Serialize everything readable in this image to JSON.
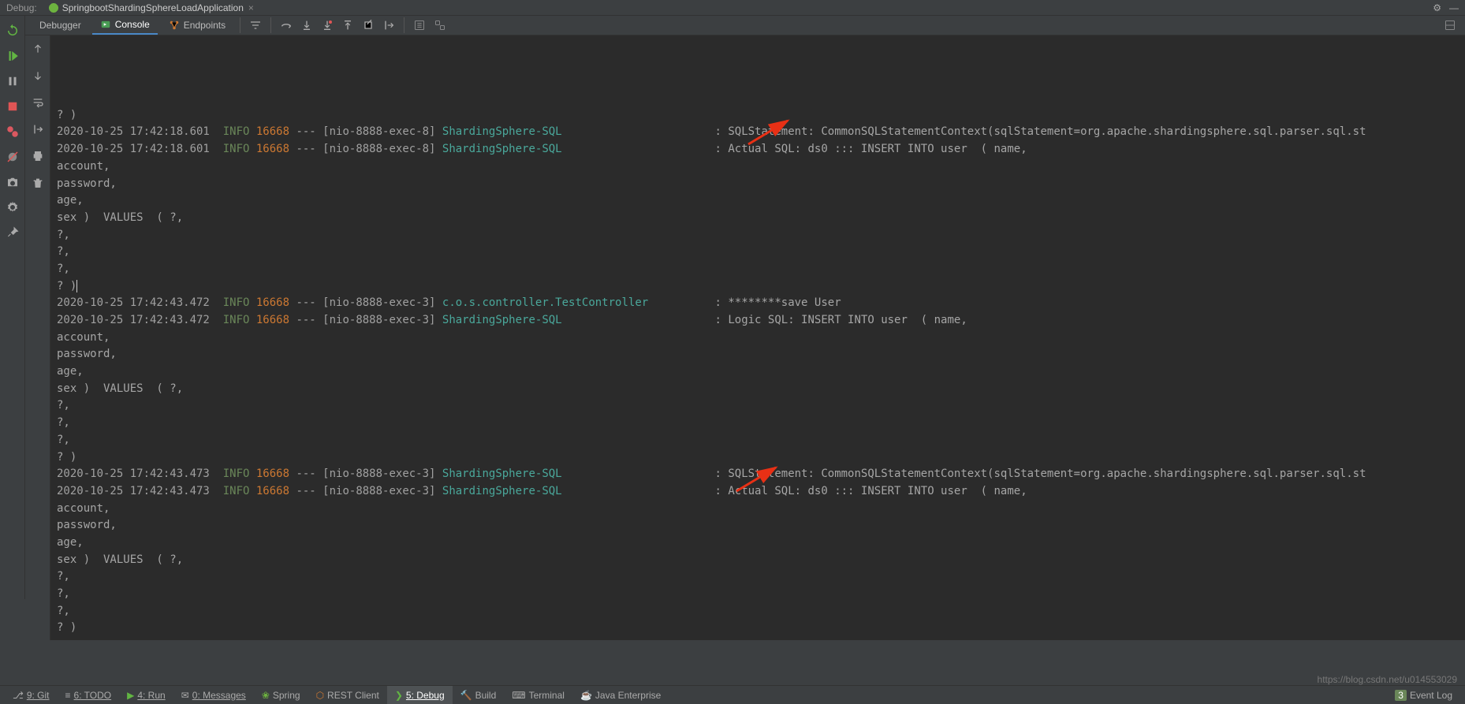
{
  "topbar": {
    "debug_label": "Debug:",
    "run_config": "SpringbootShardingSphereLoadApplication"
  },
  "toolbar": {
    "debugger": "Debugger",
    "console": "Console",
    "endpoints": "Endpoints"
  },
  "lines": [
    {
      "raw": "? )"
    },
    {
      "ts": "2020-10-25 17:42:18.601",
      "level": "INFO",
      "pid": "16668",
      "dash": " --- ",
      "thread": "[nio-8888-exec-8]",
      "logger": "ShardingSphere-SQL",
      "pad": "                       ",
      "msg": ": SQLStatement: CommonSQLStatementContext(sqlStatement=org.apache.shardingsphere.sql.parser.sql.st"
    },
    {
      "ts": "2020-10-25 17:42:18.601",
      "level": "INFO",
      "pid": "16668",
      "dash": " --- ",
      "thread": "[nio-8888-exec-8]",
      "logger": "ShardingSphere-SQL",
      "pad": "                       ",
      "msg": ": Actual SQL: ds0 ::: INSERT INTO user  ( name,"
    },
    {
      "raw": "account,"
    },
    {
      "raw": "password,"
    },
    {
      "raw": "age,"
    },
    {
      "raw": "sex )  VALUES  ( ?,"
    },
    {
      "raw": "?,"
    },
    {
      "raw": "?,"
    },
    {
      "raw": "?,"
    },
    {
      "raw": "? )",
      "cursor": true
    },
    {
      "ts": "2020-10-25 17:42:43.472",
      "level": "INFO",
      "pid": "16668",
      "dash": " --- ",
      "thread": "[nio-8888-exec-3]",
      "logger": "c.o.s.controller.TestController",
      "pad": "          ",
      "msg": ": ********save User"
    },
    {
      "ts": "2020-10-25 17:42:43.472",
      "level": "INFO",
      "pid": "16668",
      "dash": " --- ",
      "thread": "[nio-8888-exec-3]",
      "logger": "ShardingSphere-SQL",
      "pad": "                       ",
      "msg": ": Logic SQL: INSERT INTO user  ( name,"
    },
    {
      "raw": "account,"
    },
    {
      "raw": "password,"
    },
    {
      "raw": "age,"
    },
    {
      "raw": "sex )  VALUES  ( ?,"
    },
    {
      "raw": "?,"
    },
    {
      "raw": "?,"
    },
    {
      "raw": "?,"
    },
    {
      "raw": "? )"
    },
    {
      "ts": "2020-10-25 17:42:43.473",
      "level": "INFO",
      "pid": "16668",
      "dash": " --- ",
      "thread": "[nio-8888-exec-3]",
      "logger": "ShardingSphere-SQL",
      "pad": "                       ",
      "msg": ": SQLStatement: CommonSQLStatementContext(sqlStatement=org.apache.shardingsphere.sql.parser.sql.st"
    },
    {
      "ts": "2020-10-25 17:42:43.473",
      "level": "INFO",
      "pid": "16668",
      "dash": " --- ",
      "thread": "[nio-8888-exec-3]",
      "logger": "ShardingSphere-SQL",
      "pad": "                       ",
      "msg": ": Actual SQL: ds0 ::: INSERT INTO user  ( name,"
    },
    {
      "raw": "account,"
    },
    {
      "raw": "password,"
    },
    {
      "raw": "age,"
    },
    {
      "raw": "sex )  VALUES  ( ?,"
    },
    {
      "raw": "?,"
    },
    {
      "raw": "?,"
    },
    {
      "raw": "?,"
    },
    {
      "raw": "? )"
    }
  ],
  "statusbar": {
    "git": "9: Git",
    "todo": "6: TODO",
    "run": "4: Run",
    "messages": "0: Messages",
    "spring": "Spring",
    "rest": "REST Client",
    "debug": "5: Debug",
    "build": "Build",
    "terminal": "Terminal",
    "javaee": "Java Enterprise",
    "eventlog": "Event Log",
    "eventlog_badge": "3"
  },
  "watermark": "https://blog.csdn.net/u014553029"
}
